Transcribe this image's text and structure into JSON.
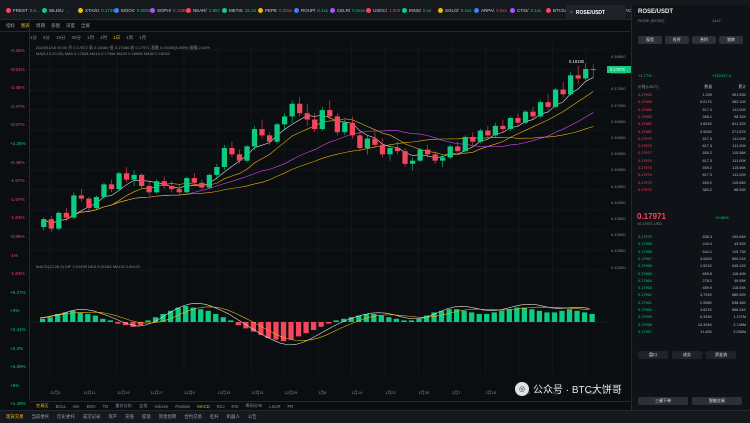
{
  "tickers": [
    {
      "name": "FREST",
      "price": "0.0..."
    },
    {
      "name": "WLD/U",
      "price": "...",
      "sign": "r"
    },
    {
      "name": "XTAI/U",
      "price": "0.1749"
    },
    {
      "name": "MOOV",
      "price": "0.00030"
    },
    {
      "name": "SOPH/",
      "price": "0.15882"
    },
    {
      "name": "NEAR/",
      "price": "1.957"
    },
    {
      "name": "METIS",
      "price": "15.15"
    },
    {
      "name": "PEPE",
      "price": "0.00xx"
    },
    {
      "name": "ROUP/",
      "price": "0.1xx"
    },
    {
      "name": "CELR/",
      "price": "0.0xxx"
    },
    {
      "name": "USDC/",
      "price": "1.000"
    },
    {
      "name": "INNS/",
      "price": "0.xx"
    },
    {
      "name": "SOLO/",
      "price": "0.2xx"
    },
    {
      "name": "ARPA/",
      "price": "0.0xx"
    },
    {
      "name": "CTSI/",
      "price": "0.1xx"
    },
    {
      "name": "BTC/U",
      "price": "xxxx"
    },
    {
      "name": "STRK/",
      "price": "0.1xx"
    },
    {
      "name": "ACOA/",
      "price": "0.xx"
    },
    {
      "name": "IMX/U",
      "price": "0.4xx"
    },
    {
      "name": "RAD/",
      "price": "x"
    }
  ],
  "pair_tab": "ROSE/USDT",
  "toolbar": [
    "指标",
    "图表",
    "周期",
    "多图",
    "深度",
    "全屏"
  ],
  "timeframes": [
    "1分",
    "5分",
    "15分",
    "30分",
    "1时",
    "4时",
    "1日",
    "1周",
    "1月"
  ],
  "left_percents": [
    {
      "v": "-0.25%",
      "c": "r"
    },
    {
      "v": "-0.51%",
      "c": "r"
    },
    {
      "v": "-2.45%",
      "c": "r"
    },
    {
      "v": "-2.47%",
      "c": "r"
    },
    {
      "v": "-0.57%",
      "c": "r"
    },
    {
      "v": "+2.26%",
      "c": "g"
    },
    {
      "v": "-0.48%",
      "c": "r"
    },
    {
      "v": "-1.67%",
      "c": "r"
    },
    {
      "v": "-1.97%",
      "c": "r"
    },
    {
      "v": "-1.63%",
      "c": "r"
    },
    {
      "v": "-0.86%",
      "c": "r"
    },
    {
      "v": "-1%",
      "c": "r"
    },
    {
      "v": "-1.63%",
      "c": "r"
    },
    {
      "v": "+0.27%",
      "c": "g"
    },
    {
      "v": "+3%",
      "c": "g"
    },
    {
      "v": "+2.41%",
      "c": "g"
    },
    {
      "v": "+2.2%",
      "c": "g"
    },
    {
      "v": "+4.39%",
      "c": "g"
    },
    {
      "v": "+5%",
      "c": "g"
    },
    {
      "v": "+1.45%",
      "c": "g"
    }
  ],
  "info_lines": {
    "line1": "2024/01/18 00:00 开 0.17872 高 0.18180 低 0.17686 收 0.17971 涨跌 0.00155(0.86%) 振幅 2.64%",
    "line2": "MA(5,10,20,30)  MA5 0.17638  MA10 0.17086  MA20 0.16656  MA30 0.16032",
    "line3": "MACD(12,26,9)  DIF 0.01495  DEA 0.01284  MACD 0.00422"
  },
  "price_scale": [
    "0.18500",
    "0.18000",
    "0.17500",
    "0.17000",
    "0.16500",
    "0.16000",
    "0.15500",
    "0.15000",
    "0.14500",
    "0.14000",
    "0.13500",
    "0.13000",
    "0.12500",
    "0.12000"
  ],
  "current_price_tag": "0.17971",
  "high_label": "0.18180",
  "low_label": "0.14000",
  "x_ticks": [
    "11月3",
    "11月11",
    "11月19",
    "11月27",
    "12月5",
    "12月13",
    "12月21",
    "12月29",
    "1月6",
    "1月14",
    "1月22",
    "1月30",
    "2月7",
    "2月15",
    "2月23",
    "3月2",
    "3月10"
  ],
  "sub_tabs": [
    "交易区",
    "BOLL",
    "MA",
    "EMA",
    "TD",
    "量价分析",
    "五档",
    "Volume",
    "Position",
    "MACD",
    "KDJ",
    "RSI",
    "筹码分布",
    "LSUR",
    "PR"
  ],
  "bottom_tabs": [
    "现货交易",
    "当前委托",
    "历史委托",
    "成交记录",
    "资产",
    "充值",
    "提现",
    "资金划转",
    "合约交易",
    "杠杆",
    "机器人",
    "公告"
  ],
  "right": {
    "pair": "ROSE/USDT",
    "fullname": "ROSE (ROSE)",
    "high_24": "1447",
    "buttons": [
      "现货",
      "杠杆",
      "合约",
      "划转"
    ],
    "change": "+1.77%",
    "volume": "+133197.4",
    "book_head": [
      "价格(USDT)",
      "数量",
      "累计"
    ],
    "asks": [
      [
        "0.17994",
        "1.209",
        "391.53K"
      ],
      [
        "0.17989",
        "5.017K",
        "382.10K"
      ],
      [
        "0.17984",
        "617.4",
        "111.00K"
      ],
      [
        "0.17983",
        "368.1",
        "98.32K"
      ],
      [
        "0.17981",
        "4.651K",
        "811.32K"
      ],
      [
        "0.17980",
        "4.992K",
        "271.87K"
      ],
      [
        "0.17979",
        "617.3",
        "111.00K"
      ],
      [
        "0.17978",
        "617.3",
        "111.00K"
      ],
      [
        "0.17977",
        "659.2",
        "115.56K"
      ],
      [
        "0.17976",
        "617.3",
        "111.00K"
      ],
      [
        "0.17975",
        "659.2",
        "115.56K"
      ],
      [
        "0.17974",
        "617.3",
        "111.00K"
      ],
      [
        "0.17973",
        "659.2",
        "115.56K"
      ],
      [
        "0.17972",
        "383.2",
        "68.93K"
      ]
    ],
    "mid_price": "0.17971",
    "mid_sub": "≈0.17971 USD",
    "mid_change": "+0.86%",
    "bids": [
      [
        "0.17970",
        "838.3",
        "150.64K"
      ],
      [
        "0.17969",
        "244.4",
        "43.92K"
      ],
      [
        "0.17968",
        "644.1",
        "115.73K"
      ],
      [
        "0.17967",
        "3.062K",
        "550.21K"
      ],
      [
        "0.17966",
        "1.921K",
        "345.12K"
      ],
      [
        "0.17965",
        "659.6",
        "118.49K"
      ],
      [
        "0.17964",
        "278.1",
        "49.95K"
      ],
      [
        "0.17963",
        "659.9",
        "118.53K"
      ],
      [
        "0.17962",
        "3.791K",
        "680.92K"
      ],
      [
        "0.17961",
        "2.998K",
        "538.46K"
      ],
      [
        "0.17960",
        "3.821K",
        "686.24K"
      ],
      [
        "0.17959",
        "6.333K",
        "1.137M"
      ],
      [
        "0.17958",
        "15.304K",
        "2.748M"
      ],
      [
        "0.17957",
        "11.45K",
        "2.056M"
      ]
    ],
    "foot_buttons": [
      "盘口",
      "成交",
      "资金流"
    ],
    "bottom_btns": [
      "三键下单",
      "智能交易"
    ]
  },
  "watermark": "公众号 · BTC大饼哥",
  "chart_data": {
    "type": "candlestick",
    "title": "ROSE/USDT",
    "ylim": [
      0.118,
      0.186
    ],
    "x_start": "11月3",
    "x_end": "3月10",
    "candles": [
      [
        0.13,
        0.133,
        0.129,
        0.1325
      ],
      [
        0.1325,
        0.1335,
        0.1285,
        0.1295
      ],
      [
        0.1295,
        0.135,
        0.129,
        0.1345
      ],
      [
        0.1345,
        0.136,
        0.132,
        0.133
      ],
      [
        0.133,
        0.141,
        0.1325,
        0.14
      ],
      [
        0.14,
        0.142,
        0.138,
        0.139
      ],
      [
        0.139,
        0.1395,
        0.135,
        0.136
      ],
      [
        0.136,
        0.14,
        0.1355,
        0.1395
      ],
      [
        0.1395,
        0.144,
        0.139,
        0.1435
      ],
      [
        0.1435,
        0.145,
        0.141,
        0.142
      ],
      [
        0.142,
        0.1475,
        0.1415,
        0.147
      ],
      [
        0.147,
        0.149,
        0.144,
        0.145
      ],
      [
        0.145,
        0.148,
        0.143,
        0.1465
      ],
      [
        0.1465,
        0.147,
        0.142,
        0.143
      ],
      [
        0.143,
        0.1445,
        0.14,
        0.141
      ],
      [
        0.141,
        0.145,
        0.1405,
        0.1445
      ],
      [
        0.1445,
        0.146,
        0.142,
        0.143
      ],
      [
        0.143,
        0.1445,
        0.141,
        0.142
      ],
      [
        0.142,
        0.1435,
        0.14,
        0.141
      ],
      [
        0.141,
        0.146,
        0.1405,
        0.1455
      ],
      [
        0.1455,
        0.147,
        0.143,
        0.144
      ],
      [
        0.144,
        0.145,
        0.142,
        0.1425
      ],
      [
        0.1425,
        0.147,
        0.142,
        0.1465
      ],
      [
        0.1465,
        0.15,
        0.145,
        0.149
      ],
      [
        0.149,
        0.156,
        0.148,
        0.155
      ],
      [
        0.155,
        0.157,
        0.152,
        0.153
      ],
      [
        0.153,
        0.1545,
        0.15,
        0.151
      ],
      [
        0.151,
        0.156,
        0.1505,
        0.1555
      ],
      [
        0.1555,
        0.162,
        0.1545,
        0.161
      ],
      [
        0.161,
        0.164,
        0.158,
        0.159
      ],
      [
        0.159,
        0.16,
        0.156,
        0.157
      ],
      [
        0.157,
        0.163,
        0.1565,
        0.1625
      ],
      [
        0.1625,
        0.166,
        0.161,
        0.165
      ],
      [
        0.165,
        0.17,
        0.163,
        0.169
      ],
      [
        0.169,
        0.171,
        0.165,
        0.166
      ],
      [
        0.166,
        0.169,
        0.162,
        0.164
      ],
      [
        0.164,
        0.166,
        0.16,
        0.161
      ],
      [
        0.161,
        0.168,
        0.1605,
        0.167
      ],
      [
        0.167,
        0.17,
        0.164,
        0.165
      ],
      [
        0.165,
        0.166,
        0.159,
        0.16
      ],
      [
        0.16,
        0.164,
        0.159,
        0.163
      ],
      [
        0.163,
        0.165,
        0.158,
        0.159
      ],
      [
        0.159,
        0.16,
        0.154,
        0.155
      ],
      [
        0.155,
        0.159,
        0.153,
        0.158
      ],
      [
        0.158,
        0.16,
        0.155,
        0.156
      ],
      [
        0.156,
        0.158,
        0.152,
        0.153
      ],
      [
        0.153,
        0.156,
        0.151,
        0.155
      ],
      [
        0.155,
        0.157,
        0.153,
        0.154
      ],
      [
        0.154,
        0.155,
        0.149,
        0.15
      ],
      [
        0.15,
        0.152,
        0.148,
        0.151
      ],
      [
        0.151,
        0.155,
        0.1505,
        0.1545
      ],
      [
        0.1545,
        0.156,
        0.152,
        0.153
      ],
      [
        0.153,
        0.154,
        0.15,
        0.151
      ],
      [
        0.151,
        0.153,
        0.149,
        0.152
      ],
      [
        0.152,
        0.156,
        0.1515,
        0.1555
      ],
      [
        0.1555,
        0.157,
        0.153,
        0.154
      ],
      [
        0.154,
        0.159,
        0.1535,
        0.1585
      ],
      [
        0.1585,
        0.16,
        0.156,
        0.157
      ],
      [
        0.157,
        0.161,
        0.1565,
        0.1605
      ],
      [
        0.1605,
        0.162,
        0.158,
        0.159
      ],
      [
        0.159,
        0.163,
        0.1585,
        0.162
      ],
      [
        0.162,
        0.164,
        0.16,
        0.161
      ],
      [
        0.161,
        0.165,
        0.1605,
        0.1645
      ],
      [
        0.1645,
        0.166,
        0.162,
        0.163
      ],
      [
        0.163,
        0.167,
        0.1625,
        0.1665
      ],
      [
        0.1665,
        0.168,
        0.164,
        0.165
      ],
      [
        0.165,
        0.17,
        0.1645,
        0.1695
      ],
      [
        0.1695,
        0.172,
        0.167,
        0.168
      ],
      [
        0.168,
        0.174,
        0.1675,
        0.1735
      ],
      [
        0.1735,
        0.176,
        0.171,
        0.172
      ],
      [
        0.172,
        0.179,
        0.1715,
        0.178
      ],
      [
        0.178,
        0.181,
        0.175,
        0.177
      ],
      [
        0.177,
        0.1818,
        0.1765,
        0.18
      ],
      [
        0.18,
        0.1815,
        0.177,
        0.1797
      ]
    ],
    "macd_bars": [
      0.2,
      0.3,
      0.5,
      0.6,
      0.7,
      0.6,
      0.5,
      0.4,
      0.2,
      0.1,
      -0.1,
      -0.2,
      -0.3,
      -0.2,
      0.1,
      0.3,
      0.5,
      0.7,
      0.9,
      1.0,
      0.9,
      0.8,
      0.7,
      0.5,
      0.3,
      0.1,
      -0.2,
      -0.4,
      -0.6,
      -0.8,
      -1.0,
      -1.1,
      -1.2,
      -1.1,
      -0.9,
      -0.7,
      -0.5,
      -0.3,
      -0.1,
      0.1,
      0.2,
      0.3,
      0.4,
      0.5,
      0.5,
      0.4,
      0.3,
      0.2,
      0.1,
      0.1,
      0.2,
      0.4,
      0.6,
      0.7,
      0.8,
      0.8,
      0.7,
      0.6,
      0.5,
      0.5,
      0.6,
      0.7,
      0.8,
      0.9,
      0.9,
      0.8,
      0.7,
      0.6,
      0.6,
      0.7,
      0.8,
      0.7,
      0.6,
      0.5
    ]
  }
}
